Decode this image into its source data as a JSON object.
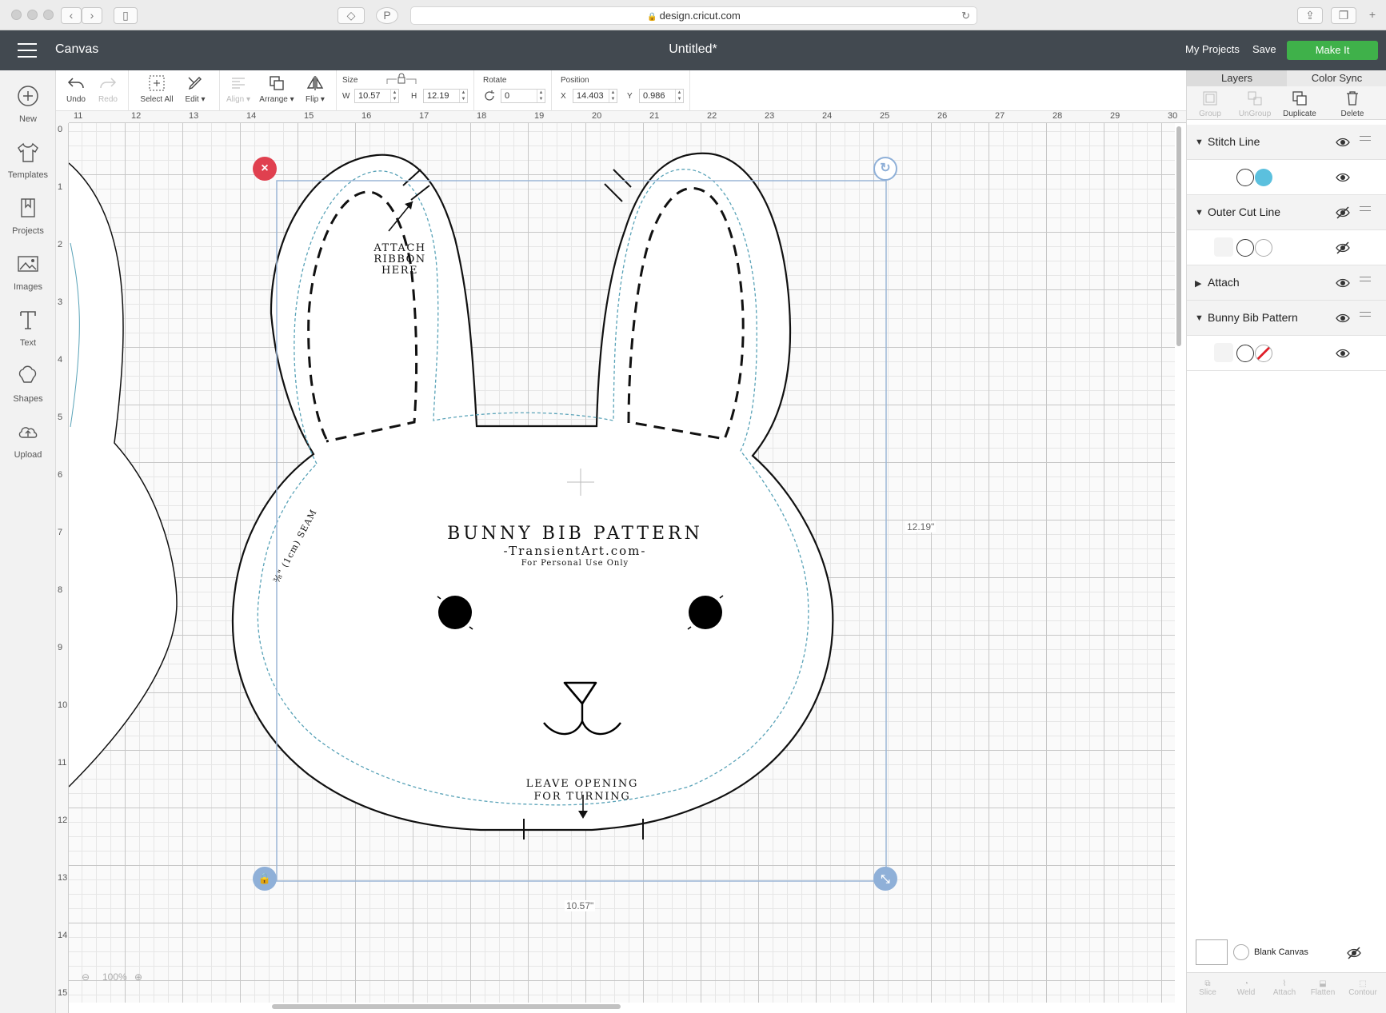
{
  "browser": {
    "url": "design.cricut.com"
  },
  "header": {
    "app_name": "Canvas",
    "doc_title": "Untitled*",
    "my_projects": "My Projects",
    "save": "Save",
    "make_it": "Make It",
    "make_it_color": "#3fb14a",
    "bar_color": "#424950"
  },
  "left_tools": [
    {
      "label": "New",
      "icon": "plus-circle-icon"
    },
    {
      "label": "Templates",
      "icon": "shirt-icon"
    },
    {
      "label": "Projects",
      "icon": "bookmark-icon"
    },
    {
      "label": "Images",
      "icon": "image-icon"
    },
    {
      "label": "Text",
      "icon": "text-icon"
    },
    {
      "label": "Shapes",
      "icon": "shapes-icon"
    },
    {
      "label": "Upload",
      "icon": "cloud-upload-icon"
    }
  ],
  "edit_bar": {
    "undo": "Undo",
    "redo": "Redo",
    "select_all": "Select All",
    "edit": "Edit",
    "align": "Align",
    "arrange": "Arrange",
    "flip": "Flip",
    "size_label": "Size",
    "w_label": "W",
    "w_value": "10.57",
    "h_label": "H",
    "h_value": "12.19",
    "rotate_label": "Rotate",
    "rotate_value": "0",
    "position_label": "Position",
    "x_label": "X",
    "x_value": "14.403",
    "y_label": "Y",
    "y_value": "0.986"
  },
  "rulers": {
    "top": [
      "11",
      "12",
      "13",
      "14",
      "15",
      "16",
      "17",
      "18",
      "19",
      "20",
      "21",
      "22",
      "23",
      "24",
      "25",
      "26",
      "27",
      "28",
      "29",
      "30"
    ],
    "left": [
      "0",
      "1",
      "2",
      "3",
      "4",
      "5",
      "6",
      "7",
      "8",
      "9",
      "10",
      "11",
      "12",
      "13",
      "14",
      "15"
    ]
  },
  "canvas": {
    "pattern_title": "BUNNY BIB PATTERN",
    "pattern_site": "-TransientArt.com-",
    "pattern_note": "For Personal Use Only",
    "ribbon_line1": "ATTACH",
    "ribbon_line2": "RIBBON",
    "ribbon_line3": "HERE",
    "opening_line1": "LEAVE OPENING",
    "opening_line2": "FOR TURNING",
    "seam_text": "⅜\" (1cm) SEAM",
    "height_dim": "12.19\"",
    "width_dim": "10.57\"",
    "zoom": "100%",
    "stitch_color": "#5aa3b8",
    "selection_color": "#9bb6d6",
    "delete_handle_color": "#e0404f",
    "handle_color": "#8fb0d8"
  },
  "right_panel": {
    "tabs": [
      "Layers",
      "Color Sync"
    ],
    "tools": [
      "Group",
      "UnGroup",
      "Duplicate",
      "Delete"
    ],
    "layers": [
      {
        "name": "Stitch Line",
        "swatch": "#5bc0de",
        "op": "pen-icon",
        "visible": true
      },
      {
        "name": "Outer Cut Line",
        "swatch": "#ffffff",
        "op": "scissors-icon",
        "visible": false
      },
      {
        "name": "Attach",
        "collapsed": true,
        "visible": true
      },
      {
        "name": "Bunny Bib Pattern",
        "op": "print-icon",
        "visible": true
      }
    ],
    "blank_canvas": "Blank Canvas",
    "bottom_tools": [
      "Slice",
      "Weld",
      "Attach",
      "Flatten",
      "Contour"
    ]
  }
}
